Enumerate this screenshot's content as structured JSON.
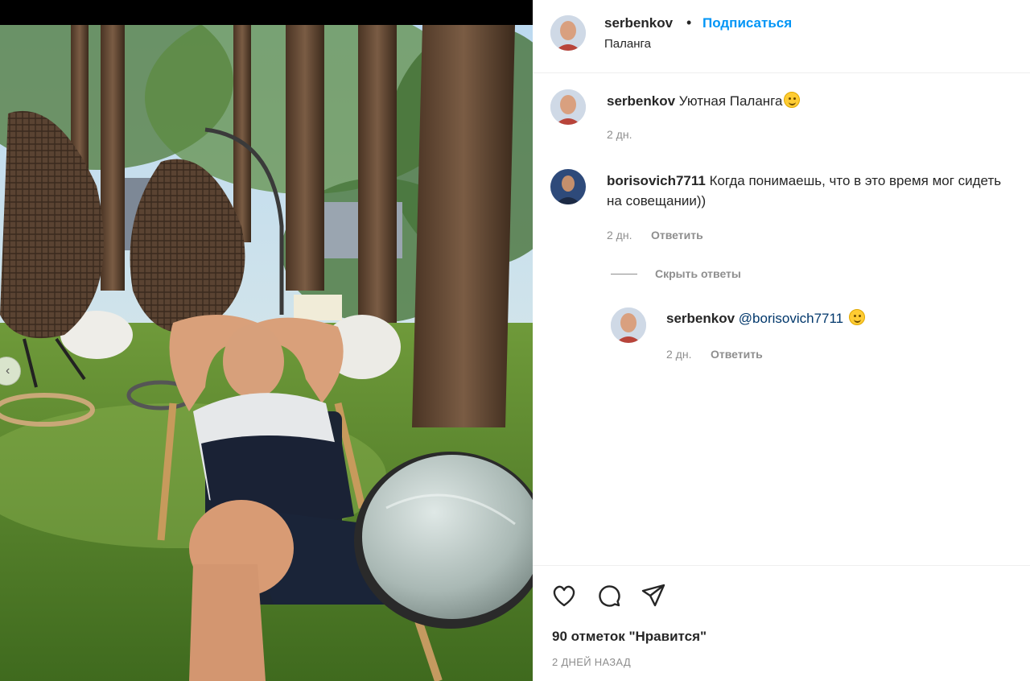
{
  "post": {
    "author": "serbenkov",
    "follow_label": "Подписаться",
    "separator": "•",
    "location": "Паланга"
  },
  "caption": {
    "username": "serbenkov",
    "text": "Уютная Паланга",
    "emoji": "slightly-smiling-face",
    "time": "2 дн."
  },
  "comments": [
    {
      "username": "borisovich7711",
      "text": "Когда понимаешь, что в это время мог сидеть на совещании))",
      "time": "2 дн.",
      "reply_label": "Ответить",
      "hide_replies_label": "Скрыть ответы",
      "replies": [
        {
          "username": "serbenkov",
          "mention": "@borisovich7711",
          "emoji": "slightly-smiling-face",
          "time": "2 дн.",
          "reply_label": "Ответить"
        }
      ]
    }
  ],
  "footer": {
    "icons": [
      "heart-icon",
      "comment-icon",
      "share-icon"
    ],
    "likes": "90 отметок \"Нравится\"",
    "date": "2 ДНЕЙ НАЗАД"
  },
  "colors": {
    "accent": "#0095f6",
    "text": "#262626",
    "muted": "#8e8e8e",
    "mention": "#00376b",
    "border": "#efefef"
  }
}
